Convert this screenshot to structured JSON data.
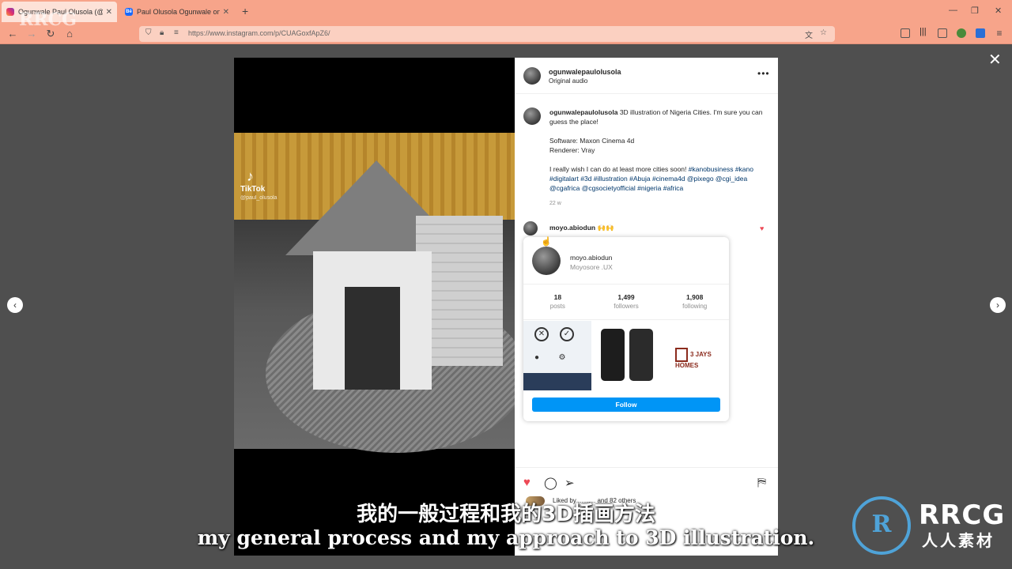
{
  "browser": {
    "tabs": [
      {
        "title": "Ogunwale Paul Olusola (@ogun",
        "icon": "instagram-icon"
      },
      {
        "title": "Paul Olusola Ogunwale on Beh",
        "icon": "behance-icon"
      }
    ],
    "tab_close": "✕",
    "new_tab": "+",
    "url": "https://www.instagram.com/p/CUAGoxfApZ6/",
    "window": {
      "minimize": "—",
      "restore": "❐",
      "close": "✕"
    }
  },
  "post": {
    "header": {
      "username": "ogunwalepaulolusola",
      "audio": "Original audio",
      "more": "•••"
    },
    "caption": {
      "username": "ogunwalepaulolusola",
      "text": "3D illustration of Nigeria Cities. I'm sure you can guess the place!",
      "software": "Software: Maxon Cinema 4d",
      "renderer": "Renderer: Vray",
      "wish": "I really wish I can do at least more cities soon!",
      "tags": "#kanobusiness #kano #digitalart #3d #illustration #Abuja #cinema4d @pixego @cgi_idea @cgafrica @cgsocietyofficial #nigeria #africa",
      "age": "22 w"
    },
    "comment": {
      "username": "moyo.abiodun",
      "emoji": "🙌🙌",
      "heart": "♥"
    },
    "hovercard": {
      "username": "moyo.abiodun",
      "full_name": "Moyosore .UX",
      "stats": [
        {
          "value": "18",
          "label": "posts"
        },
        {
          "value": "1,499",
          "label": "followers"
        },
        {
          "value": "1,908",
          "label": "following"
        }
      ],
      "brand_text": "3 JAYS HOMES",
      "follow_label": "Follow"
    },
    "media": {
      "watermark": "TikTok",
      "handle": "@paul_olusola"
    },
    "likes_text": "Liked by .......... and 82 others"
  },
  "overlay": {
    "close": "✕",
    "prev": "‹",
    "next": "›"
  },
  "subtitles": {
    "cn": "我的一般过程和我的3D插画方法",
    "en": "my general process and my approach to 3D illustration."
  },
  "watermark": {
    "brand": "RRCG",
    "cn": "人人素材",
    "top": "RRCG"
  }
}
